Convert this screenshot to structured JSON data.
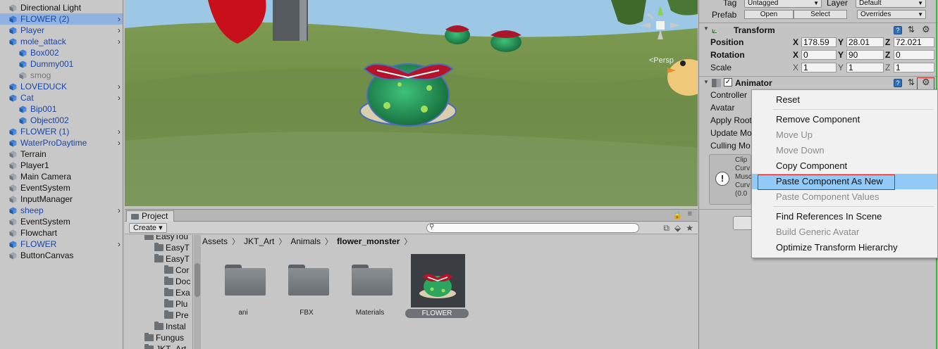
{
  "hierarchy": {
    "items": [
      {
        "label": "Directional Light",
        "color": "black",
        "indent": 0,
        "expand": "",
        "arrow": false,
        "selected": false,
        "icon": "cube-grey-icon"
      },
      {
        "label": "FLOWER (2)",
        "color": "blue",
        "indent": 0,
        "expand": "",
        "arrow": true,
        "selected": true,
        "icon": "cube-blue-icon"
      },
      {
        "label": "Player",
        "color": "blue",
        "indent": 0,
        "expand": "",
        "arrow": true,
        "selected": false,
        "icon": "cube-blue-icon"
      },
      {
        "label": "mole_attack",
        "color": "blue",
        "indent": 0,
        "expand": "▼",
        "arrow": true,
        "selected": false,
        "icon": "cube-blue-icon"
      },
      {
        "label": "Box002",
        "color": "blue",
        "indent": 1,
        "expand": "",
        "arrow": false,
        "selected": false,
        "icon": "cube-blue-icon"
      },
      {
        "label": "Dummy001",
        "color": "blue",
        "indent": 1,
        "expand": "▶",
        "arrow": false,
        "selected": false,
        "icon": "cube-blue-icon"
      },
      {
        "label": "smog",
        "color": "grey",
        "indent": 1,
        "expand": "",
        "arrow": false,
        "selected": false,
        "icon": "cube-grey-icon"
      },
      {
        "label": "LOVEDUCK",
        "color": "blue",
        "indent": 0,
        "expand": "",
        "arrow": true,
        "selected": false,
        "icon": "cube-blue-icon"
      },
      {
        "label": "Cat",
        "color": "blue",
        "indent": 0,
        "expand": "▼",
        "arrow": true,
        "selected": false,
        "icon": "cube-blue-icon"
      },
      {
        "label": "Bip001",
        "color": "blue",
        "indent": 1,
        "expand": "▶",
        "arrow": false,
        "selected": false,
        "icon": "cube-blue-icon"
      },
      {
        "label": "Object002",
        "color": "blue",
        "indent": 1,
        "expand": "",
        "arrow": false,
        "selected": false,
        "icon": "cube-blue-icon"
      },
      {
        "label": "FLOWER (1)",
        "color": "blue",
        "indent": 0,
        "expand": "",
        "arrow": true,
        "selected": false,
        "icon": "cube-blue-icon"
      },
      {
        "label": "WaterProDaytime",
        "color": "blue",
        "indent": 0,
        "expand": "",
        "arrow": true,
        "selected": false,
        "icon": "cube-blue-icon"
      },
      {
        "label": "Terrain",
        "color": "black",
        "indent": 0,
        "expand": "",
        "arrow": false,
        "selected": false,
        "icon": "cube-grey-icon"
      },
      {
        "label": "Player1",
        "color": "black",
        "indent": 0,
        "expand": "",
        "arrow": false,
        "selected": false,
        "icon": "cube-grey-icon"
      },
      {
        "label": "Main Camera",
        "color": "black",
        "indent": 0,
        "expand": "",
        "arrow": false,
        "selected": false,
        "icon": "cube-grey-icon"
      },
      {
        "label": "EventSystem",
        "color": "black",
        "indent": 0,
        "expand": "",
        "arrow": false,
        "selected": false,
        "icon": "cube-grey-icon"
      },
      {
        "label": "InputManager",
        "color": "black",
        "indent": 0,
        "expand": "",
        "arrow": false,
        "selected": false,
        "icon": "cube-grey-icon"
      },
      {
        "label": "sheep",
        "color": "blue",
        "indent": 0,
        "expand": "",
        "arrow": true,
        "selected": false,
        "icon": "cube-blue-icon"
      },
      {
        "label": "EventSystem",
        "color": "black",
        "indent": 0,
        "expand": "",
        "arrow": false,
        "selected": false,
        "icon": "cube-grey-icon"
      },
      {
        "label": "Flowchart",
        "color": "black",
        "indent": 0,
        "expand": "",
        "arrow": false,
        "selected": false,
        "icon": "cube-grey-icon"
      },
      {
        "label": "FLOWER",
        "color": "blue",
        "indent": 0,
        "expand": "",
        "arrow": true,
        "selected": false,
        "icon": "cube-blue-icon"
      },
      {
        "label": "ButtonCanvas",
        "color": "black",
        "indent": 0,
        "expand": "",
        "arrow": false,
        "selected": false,
        "icon": "cube-grey-icon"
      }
    ]
  },
  "scene": {
    "persp_label": "<Persp"
  },
  "project": {
    "tab_label": "Project",
    "create_label": "Create ▾",
    "tree": [
      {
        "label": "EasyTou",
        "indent": 0,
        "expand": "▼"
      },
      {
        "label": "EasyT",
        "indent": 1,
        "expand": "▶"
      },
      {
        "label": "EasyT",
        "indent": 1,
        "expand": "▼"
      },
      {
        "label": "Cor",
        "indent": 2,
        "expand": ""
      },
      {
        "label": "Doc",
        "indent": 2,
        "expand": ""
      },
      {
        "label": "Exa",
        "indent": 2,
        "expand": "▶"
      },
      {
        "label": "Plu",
        "indent": 2,
        "expand": "▶"
      },
      {
        "label": "Pre",
        "indent": 2,
        "expand": "▶"
      },
      {
        "label": "Instal",
        "indent": 1,
        "expand": ""
      },
      {
        "label": "Fungus",
        "indent": 0,
        "expand": "▶"
      },
      {
        "label": "JKT_Art",
        "indent": 0,
        "expand": "▼"
      }
    ],
    "breadcrumb": [
      "Assets",
      "JKT_Art",
      "Animals"
    ],
    "breadcrumb_current": "flower_monster",
    "assets": [
      {
        "label": "ani",
        "type": "folder"
      },
      {
        "label": "FBX",
        "type": "folder"
      },
      {
        "label": "Materials",
        "type": "folder"
      },
      {
        "label": "FLOWER",
        "type": "prefab"
      }
    ]
  },
  "inspector": {
    "tag_label": "Tag",
    "tag_value": "Untagged",
    "layer_label": "Layer",
    "layer_value": "Default",
    "prefab_label": "Prefab",
    "open_label": "Open",
    "select_label": "Select",
    "overrides_label": "Overrides",
    "transform": {
      "title": "Transform",
      "position_label": "Position",
      "rotation_label": "Rotation",
      "scale_label": "Scale",
      "position": {
        "x": "178.59",
        "y": "28.01",
        "z": "72.021"
      },
      "rotation": {
        "x": "0",
        "y": "90",
        "z": "0"
      },
      "scale": {
        "x": "1",
        "y": "1",
        "z": "1"
      }
    },
    "animator": {
      "title": "Animator",
      "fields": [
        "Controller",
        "Avatar",
        "Apply Root",
        "Update Mo",
        "Culling Mo"
      ],
      "info_lines": [
        "Clip",
        "Curv",
        "Musc",
        "Curv",
        "(0.0"
      ]
    }
  },
  "context_menu": {
    "items": [
      {
        "label": "Reset",
        "disabled": false,
        "highlighted": false
      },
      {
        "label": "Remove Component",
        "disabled": false,
        "highlighted": false
      },
      {
        "label": "Move Up",
        "disabled": true,
        "highlighted": false
      },
      {
        "label": "Move Down",
        "disabled": true,
        "highlighted": false
      },
      {
        "label": "Copy Component",
        "disabled": false,
        "highlighted": false
      },
      {
        "label": "Paste Component As New",
        "disabled": false,
        "highlighted": true
      },
      {
        "label": "Paste Component Values",
        "disabled": true,
        "highlighted": false
      },
      {
        "label": "Find References In Scene",
        "disabled": false,
        "highlighted": false
      },
      {
        "label": "Build Generic Avatar",
        "disabled": true,
        "highlighted": false
      },
      {
        "label": "Optimize Transform Hierarchy",
        "disabled": false,
        "highlighted": false
      }
    ]
  },
  "colors": {
    "selection": "#8fb2e0",
    "prefab_blue": "#1a45a8",
    "menu_highlight": "#91c9f7",
    "annotation_red": "#d21f1f"
  }
}
